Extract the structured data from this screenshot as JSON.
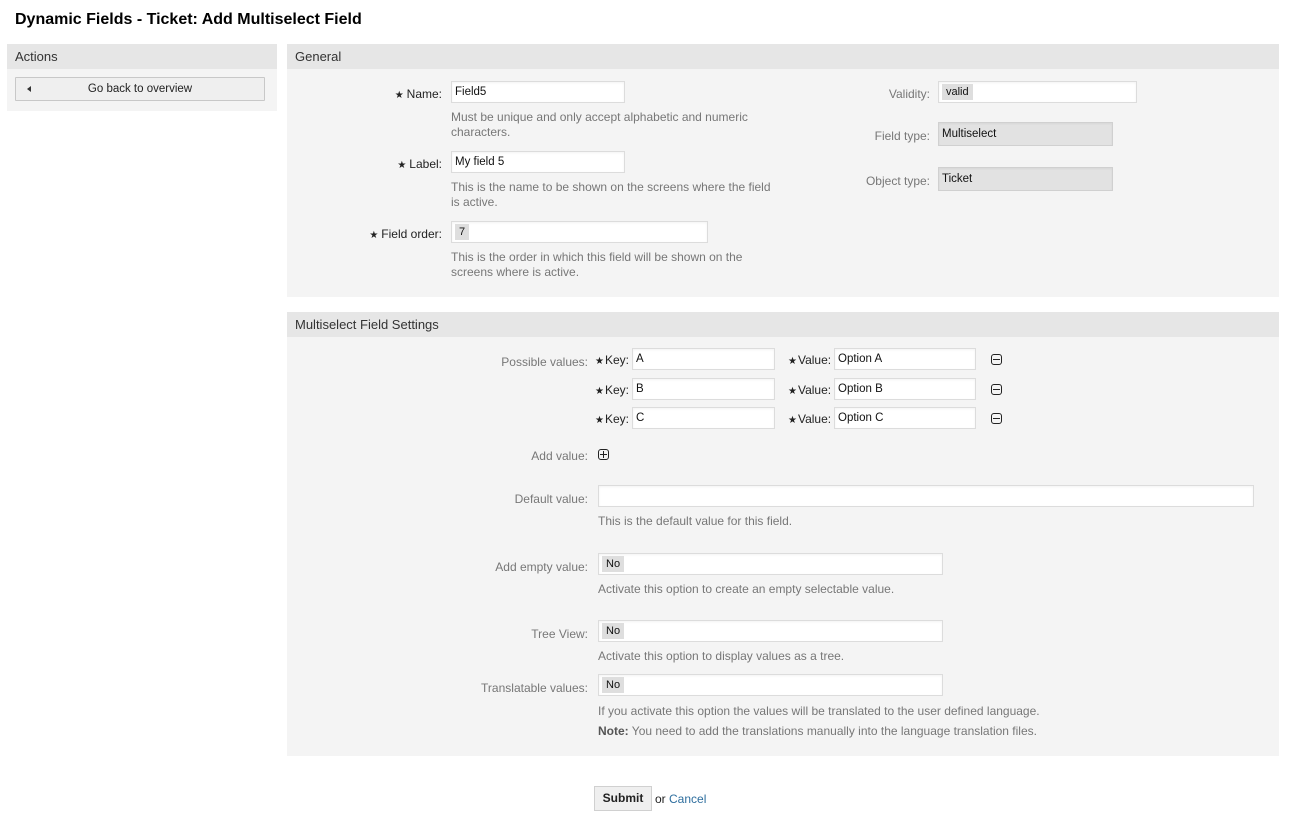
{
  "page": {
    "title": "Dynamic Fields - Ticket: Add Multiselect Field"
  },
  "sidebar": {
    "header": "Actions",
    "back_button": "Go back to overview"
  },
  "general": {
    "header": "General",
    "name": {
      "label": "Name:",
      "value": "Field5",
      "help": "Must be unique and only accept alphabetic and numeric characters.",
      "required": true
    },
    "label": {
      "label": "Label:",
      "value": "My field 5",
      "help": "This is the name to be shown on the screens where the field is active.",
      "required": true
    },
    "field_order": {
      "label": "Field order:",
      "value": "7",
      "help": "This is the order in which this field will be shown on the screens where is active.",
      "required": true
    },
    "validity": {
      "label": "Validity:",
      "value": "valid"
    },
    "field_type": {
      "label": "Field type:",
      "value": "Multiselect"
    },
    "object_type": {
      "label": "Object type:",
      "value": "Ticket"
    }
  },
  "settings": {
    "header": "Multiselect Field Settings",
    "possible_values_label": "Possible values:",
    "key_label": "Key:",
    "value_label": "Value:",
    "possible_values": [
      {
        "key": "A",
        "value": "Option A"
      },
      {
        "key": "B",
        "value": "Option B"
      },
      {
        "key": "C",
        "value": "Option C"
      }
    ],
    "add_value_label": "Add value:",
    "default_value": {
      "label": "Default value:",
      "value": "",
      "help": "This is the default value for this field."
    },
    "add_empty_value": {
      "label": "Add empty value:",
      "value": "No",
      "help": "Activate this option to create an empty selectable value."
    },
    "tree_view": {
      "label": "Tree View:",
      "value": "No",
      "help": "Activate this option to display values as a tree."
    },
    "translatable_values": {
      "label": "Translatable values:",
      "value": "No",
      "help": "If you activate this option the values will be translated to the user defined language.",
      "note_label": "Note:",
      "note": " You need to add the translations manually into the language translation files."
    }
  },
  "footer": {
    "submit": "Submit",
    "or": "or",
    "cancel": "Cancel"
  }
}
